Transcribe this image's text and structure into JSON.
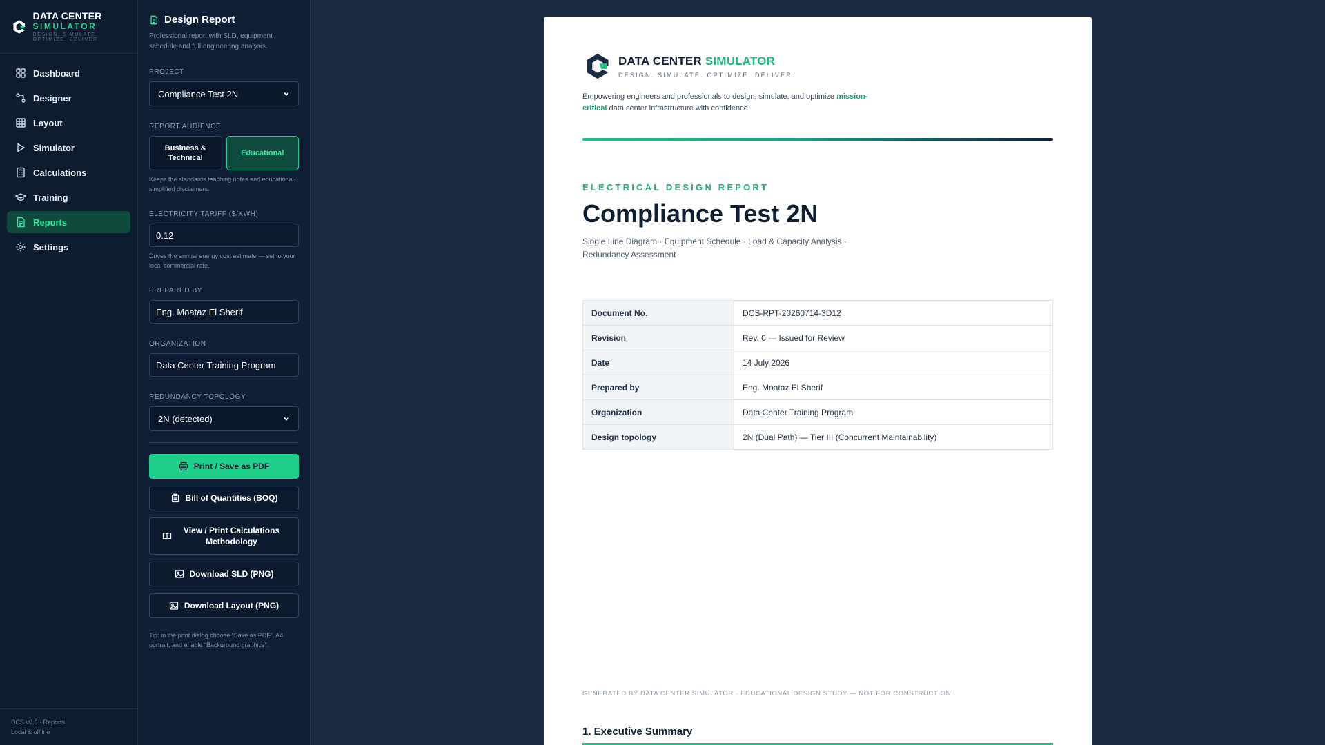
{
  "brand": {
    "line1": "DATA CENTER",
    "line2": "SIMULATOR",
    "tagline": "DESIGN. SIMULATE. OPTIMIZE. DELIVER."
  },
  "nav": {
    "items": [
      {
        "label": "Dashboard",
        "icon": "dashboard-icon"
      },
      {
        "label": "Designer",
        "icon": "designer-icon"
      },
      {
        "label": "Layout",
        "icon": "grid-icon"
      },
      {
        "label": "Simulator",
        "icon": "play-icon"
      },
      {
        "label": "Calculations",
        "icon": "calculator-icon"
      },
      {
        "label": "Training",
        "icon": "graduation-cap-icon"
      },
      {
        "label": "Reports",
        "icon": "document-icon",
        "active": true
      },
      {
        "label": "Settings",
        "icon": "gear-icon"
      }
    ],
    "footer_line1": "DCS v0.6 · Reports",
    "footer_line2": "Local & offline"
  },
  "panel": {
    "title": "Design Report",
    "subtitle": "Professional report with SLD, equipment schedule and full engineering analysis.",
    "project_label": "PROJECT",
    "project_value": "Compliance Test 2N",
    "audience_label": "REPORT AUDIENCE",
    "audience_options": [
      "Business & Technical",
      "Educational"
    ],
    "audience_selected": "Educational",
    "audience_hint": "Keeps the standards teaching notes and educational-simplified disclaimers.",
    "tariff_label": "ELECTRICITY TARIFF ($/KWH)",
    "tariff_value": "0.12",
    "tariff_hint": "Drives the annual energy cost estimate — set to your local commercial rate.",
    "prepared_by_label": "PREPARED BY",
    "prepared_by_value": "Eng. Moataz El Sherif",
    "organization_label": "ORGANIZATION",
    "organization_value": "Data Center Training Program",
    "topology_label": "REDUNDANCY TOPOLOGY",
    "topology_value": "2N (detected)",
    "buttons": {
      "print": "Print / Save as PDF",
      "boq": "Bill of Quantities (BOQ)",
      "methodology": "View / Print Calculations Methodology",
      "sld": "Download SLD (PNG)",
      "layout": "Download Layout (PNG)"
    },
    "tip": "Tip: in the print dialog choose “Save as PDF”, A4 portrait, and enable “Background graphics”."
  },
  "document": {
    "brand_title_a": "DATA CENTER ",
    "brand_title_b": "SIMULATOR",
    "brand_tag": "DESIGN. SIMULATE. OPTIMIZE. DELIVER.",
    "blurb_a": "Empowering engineers and professionals to design, simulate, and optimize ",
    "blurb_hl": "mission-critical",
    "blurb_b": " data center infrastructure with confidence.",
    "kicker": "ELECTRICAL DESIGN REPORT",
    "title": "Compliance Test 2N",
    "subtitle": "Single Line Diagram · Equipment Schedule · Load & Capacity Analysis · Redundancy Assessment",
    "meta": [
      {
        "key": "Document No.",
        "value": "DCS-RPT-20260714-3D12"
      },
      {
        "key": "Revision",
        "value": "Rev. 0 — Issued for Review"
      },
      {
        "key": "Date",
        "value": "14 July 2026"
      },
      {
        "key": "Prepared by",
        "value": "Eng. Moataz El Sherif"
      },
      {
        "key": "Organization",
        "value": "Data Center Training Program"
      },
      {
        "key": "Design topology",
        "value": "2N (Dual Path) — Tier III (Concurrent Maintainability)"
      }
    ],
    "footnote": "GENERATED BY DATA CENTER SIMULATOR · EDUCATIONAL DESIGN STUDY — NOT FOR CONSTRUCTION",
    "section_heading": "1. Executive Summary"
  },
  "colors": {
    "accent": "#1fd08b",
    "nav_bg": "#0e1c30",
    "panel_bg": "#0f2036",
    "canvas_bg": "#1a2a42"
  }
}
